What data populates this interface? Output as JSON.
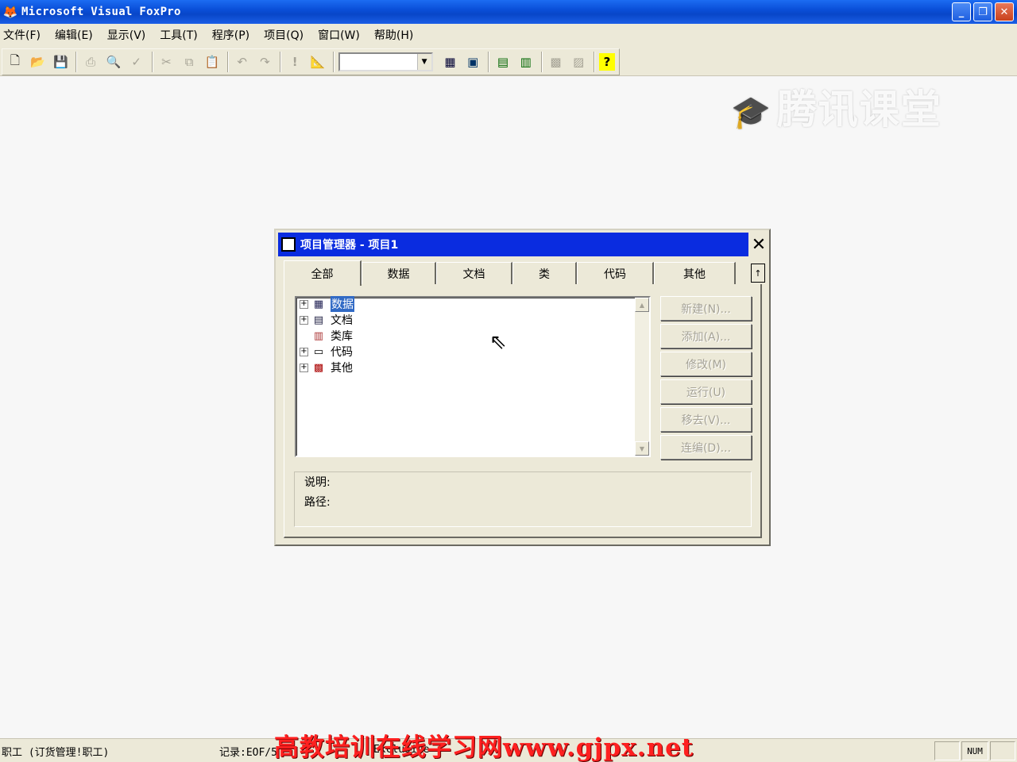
{
  "window": {
    "title": "Microsoft Visual FoxPro",
    "minimize": "_",
    "restore": "❐",
    "close": "✕"
  },
  "menu": [
    "文件(F)",
    "编辑(E)",
    "显示(V)",
    "工具(T)",
    "程序(P)",
    "项目(Q)",
    "窗口(W)",
    "帮助(H)"
  ],
  "watermark": "腾讯课堂",
  "dialog": {
    "title": "项目管理器 - 项目1",
    "close": "✕",
    "tabs": [
      "全部",
      "数据",
      "文档",
      "类",
      "代码",
      "其他"
    ],
    "tab_scroll": "↑",
    "tree": [
      {
        "label": "数据",
        "expandable": true,
        "icon": "database-icon",
        "selected": true
      },
      {
        "label": "文档",
        "expandable": true,
        "icon": "document-icon",
        "selected": false
      },
      {
        "label": "类库",
        "expandable": false,
        "icon": "class-library-icon",
        "selected": false
      },
      {
        "label": "代码",
        "expandable": true,
        "icon": "code-icon",
        "selected": false
      },
      {
        "label": "其他",
        "expandable": true,
        "icon": "other-icon",
        "selected": false
      }
    ],
    "buttons": [
      "新建(N)...",
      "添加(A)...",
      "修改(M)",
      "运行(U)",
      "移去(V)...",
      "连编(D)..."
    ],
    "description_label": "说明:",
    "path_label": "路径:"
  },
  "status": {
    "table": "职工 (订货管理!职工)",
    "record": "记录:EOF/5",
    "exclusive": "Exclusive",
    "num": "NUM"
  },
  "banner": "高教培训在线学习网www.gjpx.net"
}
